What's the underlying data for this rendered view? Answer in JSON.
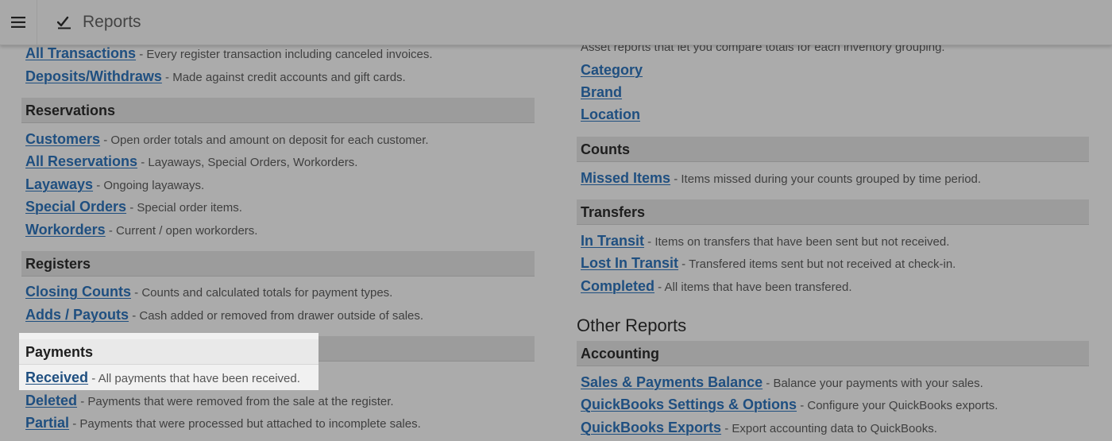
{
  "header": {
    "title": "Reports",
    "menu_icon": "hamburger-menu-icon",
    "title_icon": "chart-check-icon"
  },
  "left": {
    "top_rows": [
      {
        "link": "All Transactions",
        "desc": " - Every register transaction including canceled invoices."
      },
      {
        "link": "Deposits/Withdraws",
        "desc": " - Made against credit accounts and gift cards."
      }
    ],
    "reservations": {
      "heading": "Reservations",
      "rows": [
        {
          "link": "Customers",
          "desc": " - Open order totals and amount on deposit for each customer."
        },
        {
          "link": "All Reservations",
          "desc": " - Layaways, Special Orders, Workorders."
        },
        {
          "link": "Layaways",
          "desc": " - Ongoing layaways."
        },
        {
          "link": "Special Orders",
          "desc": " - Special order items."
        },
        {
          "link": "Workorders",
          "desc": " - Current / open workorders."
        }
      ]
    },
    "registers": {
      "heading": "Registers",
      "rows": [
        {
          "link": "Closing Counts",
          "desc": " - Counts and calculated totals for payment types."
        },
        {
          "link": "Adds / Payouts",
          "desc": " - Cash added or removed from drawer outside of sales."
        }
      ]
    },
    "payments": {
      "heading": "Payments",
      "rows": [
        {
          "link": "Received",
          "desc": " - All payments that have been received."
        },
        {
          "link": "Deleted",
          "desc": " - Payments that were removed from the sale at the register."
        },
        {
          "link": "Partial",
          "desc": " - Payments that were processed but attached to incomplete sales."
        }
      ]
    }
  },
  "right": {
    "intro": "Asset reports that let you compare totals for each inventory grouping.",
    "asset_rows": [
      {
        "link": "Category"
      },
      {
        "link": "Brand"
      },
      {
        "link": "Location"
      }
    ],
    "counts": {
      "heading": "Counts",
      "rows": [
        {
          "link": "Missed Items",
          "desc": " - Items missed during your counts grouped by time period."
        }
      ]
    },
    "transfers": {
      "heading": "Transfers",
      "rows": [
        {
          "link": "In Transit",
          "desc": " - Items on transfers that have been sent but not received."
        },
        {
          "link": "Lost In Transit",
          "desc": " - Transfered items sent but not received at check-in."
        },
        {
          "link": "Completed",
          "desc": " - All items that have been transfered."
        }
      ]
    },
    "other_reports": {
      "title": "Other Reports",
      "accounting": {
        "heading": "Accounting",
        "rows": [
          {
            "link": "Sales & Payments Balance",
            "desc": " - Balance your payments with your sales."
          },
          {
            "link": "QuickBooks Settings & Options",
            "desc": " - Configure your QuickBooks exports."
          },
          {
            "link": "QuickBooks Exports",
            "desc": " - Export accounting data to QuickBooks."
          }
        ]
      }
    }
  },
  "colors": {
    "link": "#1f4f80",
    "overlay": "#ababab",
    "spotlight": "#f1f1f1"
  }
}
